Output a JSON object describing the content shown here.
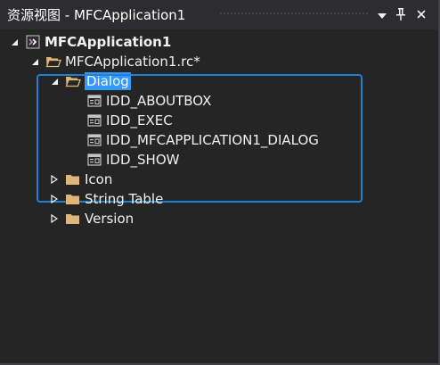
{
  "window": {
    "title": "资源视图 - MFCApplication1",
    "dropdown_icon": "chevron-down-icon",
    "pin_icon": "pin-icon",
    "close_icon": "close-icon"
  },
  "tree": {
    "project": {
      "label": "MFCApplication1",
      "icon": "project-icon",
      "expanded": true
    },
    "rc_file": {
      "label": "MFCApplication1.rc*",
      "icon": "open-folder-icon",
      "expanded": true
    },
    "dialog_folder": {
      "label": "Dialog",
      "icon": "open-folder-icon",
      "expanded": true,
      "selected": true,
      "items": [
        {
          "label": "IDD_ABOUTBOX",
          "icon": "dialog-icon"
        },
        {
          "label": "IDD_EXEC",
          "icon": "dialog-icon"
        },
        {
          "label": "IDD_MFCAPPLICATION1_DIALOG",
          "icon": "dialog-icon"
        },
        {
          "label": "IDD_SHOW",
          "icon": "dialog-icon"
        }
      ]
    },
    "other_folders": [
      {
        "label": "Icon",
        "icon": "folder-icon",
        "expanded": false
      },
      {
        "label": "String Table",
        "icon": "folder-icon",
        "expanded": false
      },
      {
        "label": "Version",
        "icon": "folder-icon",
        "expanded": false
      }
    ]
  },
  "colors": {
    "background": "#252526",
    "titlebar": "#2d2d30",
    "selection": "#3399ff",
    "focus_border": "#1e82d4",
    "folder": "#dcb67a",
    "text": "#f1f1f1"
  }
}
